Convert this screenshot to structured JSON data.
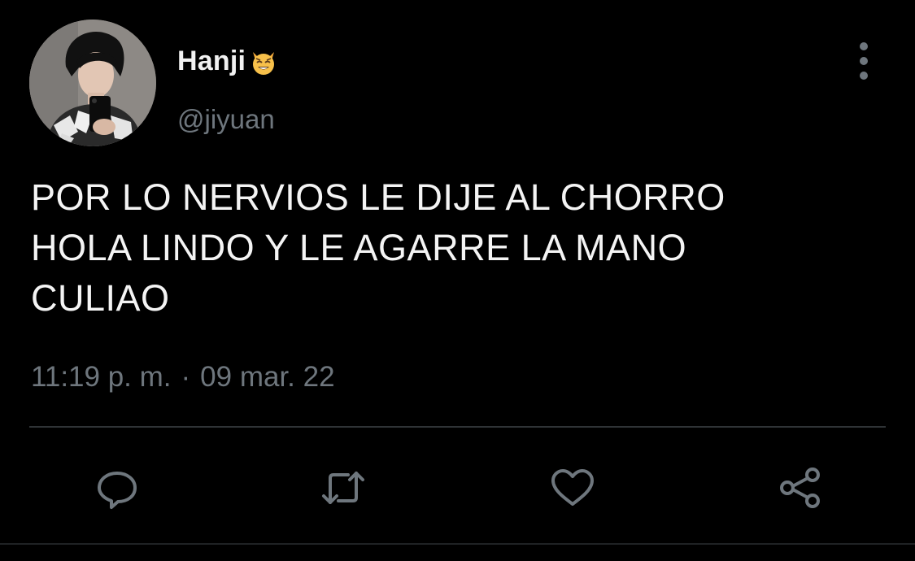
{
  "tweet": {
    "display_name": "Hanji",
    "badge_emoji": "smiling-cat-with-horns-icon",
    "handle": "@jiyuan",
    "text": "POR LO NERVIOS LE DIJE AL CHORRO\nHOLA LINDO Y LE AGARRE LA MANO\nCULIAO",
    "time": "11:19 p. m.",
    "separator": "·",
    "date": "09 mar. 22"
  },
  "actions": [
    {
      "name": "reply",
      "icon": "comment-icon"
    },
    {
      "name": "retweet",
      "icon": "retweet-icon"
    },
    {
      "name": "like",
      "icon": "heart-icon"
    },
    {
      "name": "share",
      "icon": "share-icon"
    }
  ],
  "colors": {
    "background": "#000000",
    "primary_text": "#f4f4f4",
    "secondary_text": "#6e767d",
    "divider": "#2f3336"
  }
}
